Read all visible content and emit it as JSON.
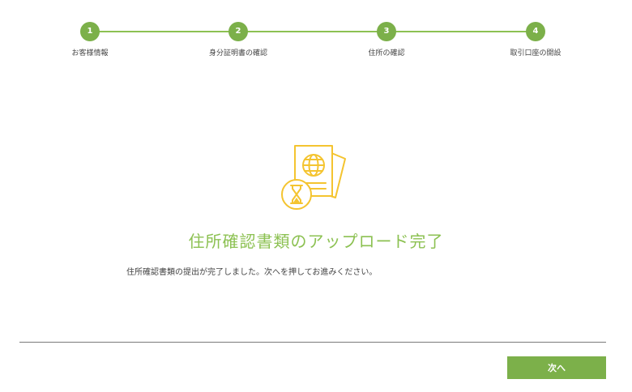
{
  "stepper": {
    "steps": [
      {
        "number": "1",
        "label": "お客様情報"
      },
      {
        "number": "2",
        "label": "身分証明書の確認"
      },
      {
        "number": "3",
        "label": "住所の確認"
      },
      {
        "number": "4",
        "label": "取引口座の開設"
      }
    ]
  },
  "main": {
    "title": "住所確認書類のアップロード完了",
    "message": "住所確認書類の提出が完了しました。次へを押してお進みください。",
    "illustration_icon": "passport-hourglass-icon"
  },
  "footer": {
    "next_label": "次へ"
  },
  "colors": {
    "accent": "#8cc152",
    "button": "#7cb04a",
    "illustration": "#f4c430"
  }
}
